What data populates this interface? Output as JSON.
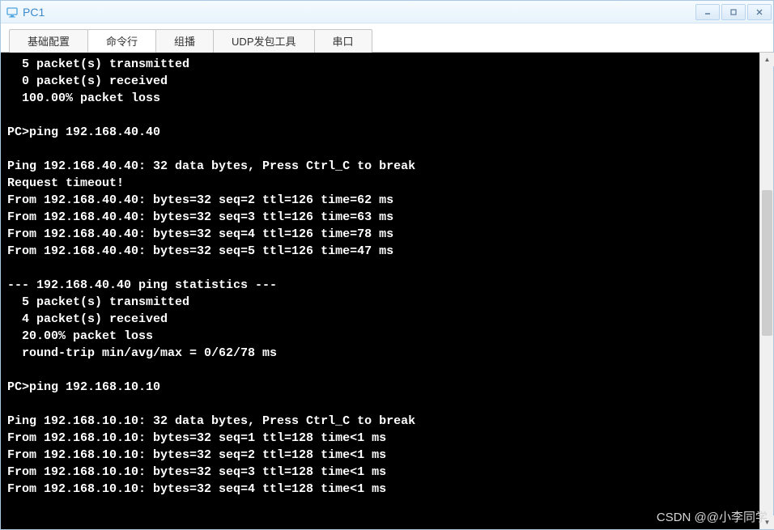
{
  "window": {
    "title": "PC1"
  },
  "tabs": {
    "basic": "基础配置",
    "cli": "命令行",
    "multicast": "组播",
    "udp": "UDP发包工具",
    "serial": "串口"
  },
  "terminal": {
    "lines": [
      "  5 packet(s) transmitted",
      "  0 packet(s) received",
      "  100.00% packet loss",
      "",
      "PC>ping 192.168.40.40",
      "",
      "Ping 192.168.40.40: 32 data bytes, Press Ctrl_C to break",
      "Request timeout!",
      "From 192.168.40.40: bytes=32 seq=2 ttl=126 time=62 ms",
      "From 192.168.40.40: bytes=32 seq=3 ttl=126 time=63 ms",
      "From 192.168.40.40: bytes=32 seq=4 ttl=126 time=78 ms",
      "From 192.168.40.40: bytes=32 seq=5 ttl=126 time=47 ms",
      "",
      "--- 192.168.40.40 ping statistics ---",
      "  5 packet(s) transmitted",
      "  4 packet(s) received",
      "  20.00% packet loss",
      "  round-trip min/avg/max = 0/62/78 ms",
      "",
      "PC>ping 192.168.10.10",
      "",
      "Ping 192.168.10.10: 32 data bytes, Press Ctrl_C to break",
      "From 192.168.10.10: bytes=32 seq=1 ttl=128 time<1 ms",
      "From 192.168.10.10: bytes=32 seq=2 ttl=128 time<1 ms",
      "From 192.168.10.10: bytes=32 seq=3 ttl=128 time<1 ms",
      "From 192.168.10.10: bytes=32 seq=4 ttl=128 time<1 ms"
    ]
  },
  "watermark": "CSDN @@小李同学"
}
